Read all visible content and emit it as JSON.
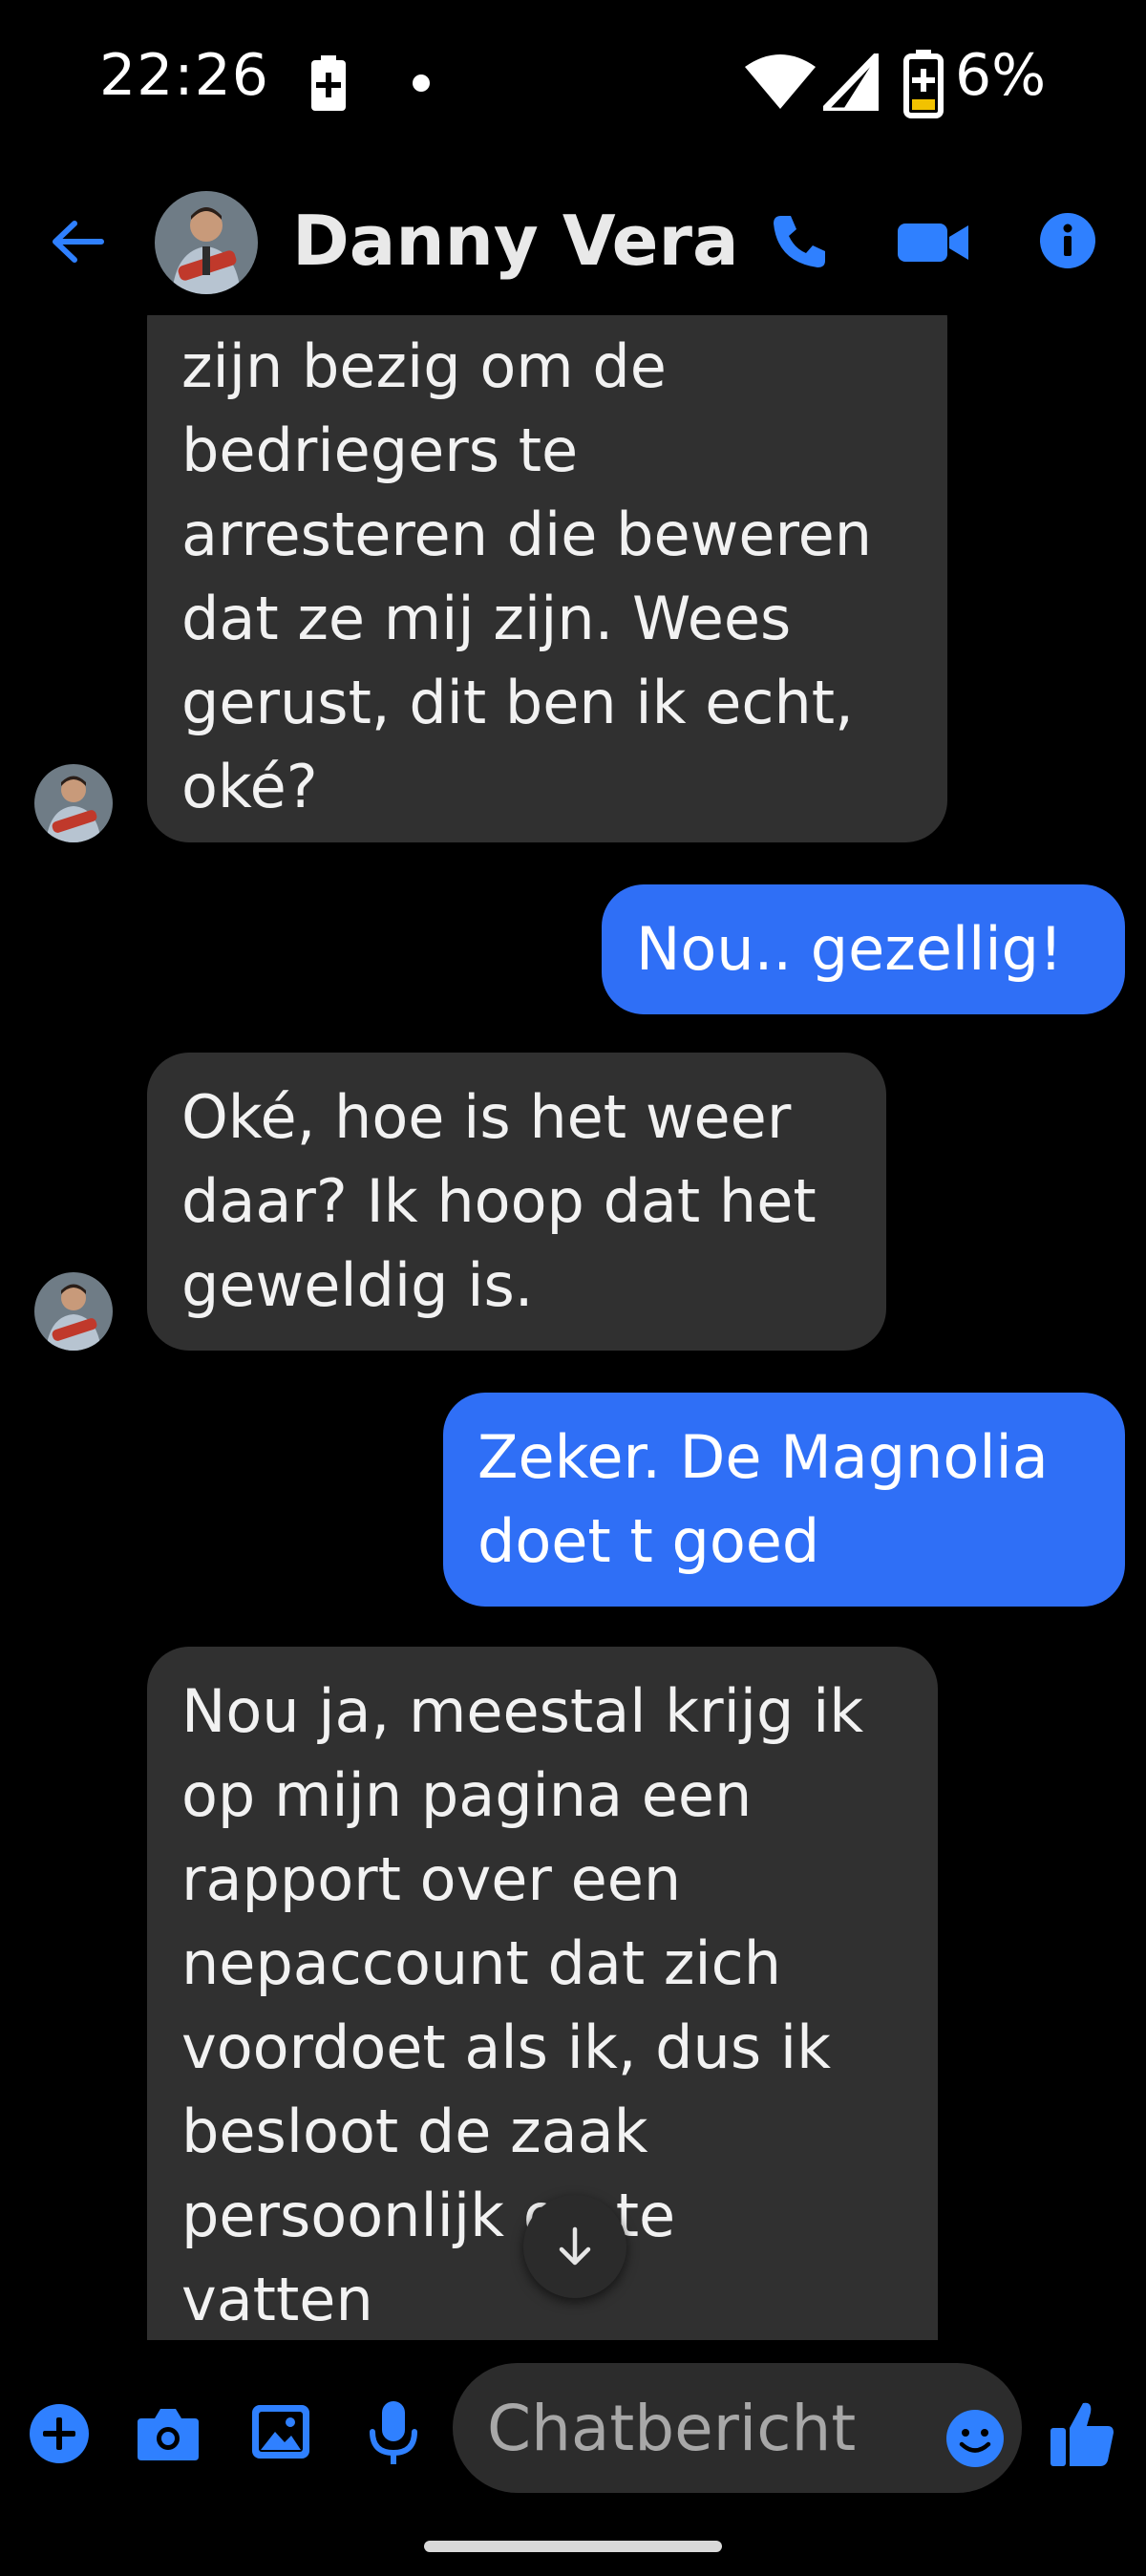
{
  "status_bar": {
    "time": "22:26",
    "battery_percent": "6%"
  },
  "header": {
    "contact_name": "Danny Vera"
  },
  "messages": [
    {
      "direction": "incoming",
      "lines": [
        "zijn bezig om de",
        "bedriegers te",
        "arresteren die beweren",
        "dat ze mij zijn. Wees",
        "gerust, dit ben ik echt,",
        "oké?"
      ]
    },
    {
      "direction": "outgoing",
      "lines": [
        "Nou.. gezellig!"
      ]
    },
    {
      "direction": "incoming",
      "lines": [
        "Oké, hoe is het weer",
        "daar? Ik hoop dat het",
        "geweldig is."
      ]
    },
    {
      "direction": "outgoing",
      "lines": [
        "Zeker. De Magnolia",
        "doet t goed"
      ]
    },
    {
      "direction": "incoming",
      "lines": [
        "Nou ja, meestal krijg ik",
        "op mijn pagina een",
        "rapport over een",
        "nepaccount dat zich",
        "voordoet als ik, dus ik",
        "besloot de zaak",
        "persoonlijk op te",
        "vatten"
      ]
    }
  ],
  "composer": {
    "placeholder": "Chatbericht"
  },
  "colors": {
    "accent": "#2f6ff6",
    "incoming_bubble": "#303030",
    "background": "#000000"
  },
  "icons": {
    "back": "arrow-left",
    "call": "phone",
    "video": "video-camera",
    "info": "info-circle",
    "add": "plus-circle",
    "camera": "camera",
    "image": "image",
    "mic": "microphone",
    "emoji": "smiley",
    "like": "thumbs-up",
    "scroll": "arrow-down"
  }
}
